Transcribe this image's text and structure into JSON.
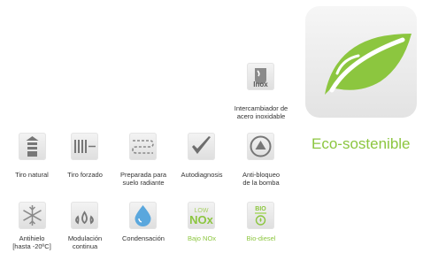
{
  "features": {
    "inox": {
      "badge": "Inox",
      "label_line1": "Intercambiador de",
      "label_line2": "acero inoxidable"
    },
    "tiro_natural": {
      "label_line1": "Tiro natural"
    },
    "tiro_forzado": {
      "label_line1": "Tiro forzado"
    },
    "suelo_radiante": {
      "label_line1": "Preparada para",
      "label_line2": "suelo radiante"
    },
    "autodiagnosis": {
      "label_line1": "Autodiagnosis"
    },
    "anti_bloqueo": {
      "label_line1": "Anti-bloqueo",
      "label_line2": "de la bomba"
    },
    "antihielo": {
      "label_line1": "Antihielo",
      "label_line2": "[hasta -20ºC]"
    },
    "modulacion": {
      "label_line1": "Modulación",
      "label_line2": "continua"
    },
    "condensacion": {
      "label_line1": "Condensación"
    },
    "bajo_nox": {
      "icon_top": "LOW",
      "icon_main": "NOx",
      "label_line1": "Bajo NOx"
    },
    "bio_diesel": {
      "icon_top": "BIO",
      "label_line1": "Bio-diesel"
    }
  },
  "eco": {
    "label": "Eco-sostenible"
  },
  "icons": {
    "inox": "inox-tank-icon",
    "tiro_natural": "chimney-icon",
    "tiro_forzado": "fan-vent-icon",
    "suelo_radiante": "floor-heating-icon",
    "autodiagnosis": "checkmark-icon",
    "anti_bloqueo": "pump-icon",
    "antihielo": "snowflake-icon",
    "modulacion": "flames-icon",
    "condensacion": "water-drop-icon",
    "bajo_nox": "low-nox-icon",
    "bio_diesel": "bio-diesel-icon",
    "eco": "leaf-icon"
  },
  "colors": {
    "accent_green": "#8cc63f",
    "icon_gray": "#7a7a7a",
    "drop_blue": "#5aa7dd"
  }
}
